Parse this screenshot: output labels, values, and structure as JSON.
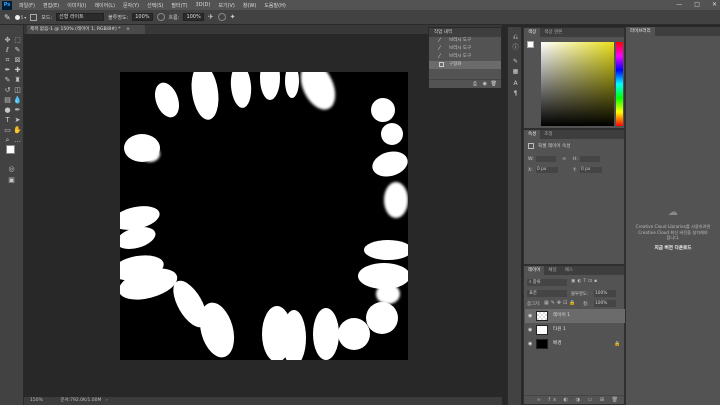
{
  "app": {
    "logo": "Ps"
  },
  "menu": [
    "파일(F)",
    "편집(E)",
    "이미지(I)",
    "레이어(L)",
    "문자(Y)",
    "선택(S)",
    "필터(T)",
    "3D(D)",
    "보기(V)",
    "창(W)",
    "도움말(H)"
  ],
  "window_controls": {
    "minimize": "—",
    "maximize": "□",
    "close": "✕"
  },
  "options": {
    "brush_size": "5",
    "mode_label": "모드:",
    "mode_value": "선형 라이트",
    "opacity_label": "불투명도:",
    "opacity_value": "100%",
    "flow_label": "흐름:",
    "flow_value": "100%"
  },
  "document": {
    "tab_title": "제목 없음-1 @ 150% (레이어 1, RGB/8#) *",
    "tab_close": "×",
    "zoom": "150%",
    "doc_info": "문서:792.0K/1.00M",
    "status_arrow": "›"
  },
  "history": {
    "title": "작업 내역",
    "items": [
      "브러시 도구",
      "브러시 도구",
      "브러시 도구",
      "구형화"
    ],
    "selected_index": 3
  },
  "color_panel": {
    "tabs": [
      "색상",
      "색상 견본"
    ],
    "fg_color": "#ffffff",
    "bg_color": "#000000",
    "picker_hue": "#e8e01a"
  },
  "properties_panel": {
    "tabs": [
      "속성",
      "조정"
    ],
    "heading": "픽셀 레이어 속성",
    "w_label": "W:",
    "h_label": "H:",
    "x_label": "X:",
    "x_value": "0 px",
    "y_label": "Y:",
    "y_value": "0 px"
  },
  "libraries": {
    "tab": "라이브러리",
    "message_1": "Creative Cloud Libraries를 사용하려면",
    "message_2": "Creative Cloud 최신 버전을 설치해야",
    "message_3": "합니다.",
    "link": "지금 버전 다운로드"
  },
  "layers_panel": {
    "tabs": [
      "레이어",
      "채널",
      "패스"
    ],
    "kind_label": "종류",
    "blend_mode": "표준",
    "opacity_label": "불투명도:",
    "opacity_value": "100%",
    "lock_label": "잠그기:",
    "fill_label": "칠:",
    "fill_value": "100%",
    "layers": [
      {
        "name": "레이어 1",
        "selected": true
      },
      {
        "name": "타원 1",
        "selected": false
      },
      {
        "name": "배경",
        "selected": false,
        "locked": true
      }
    ]
  }
}
